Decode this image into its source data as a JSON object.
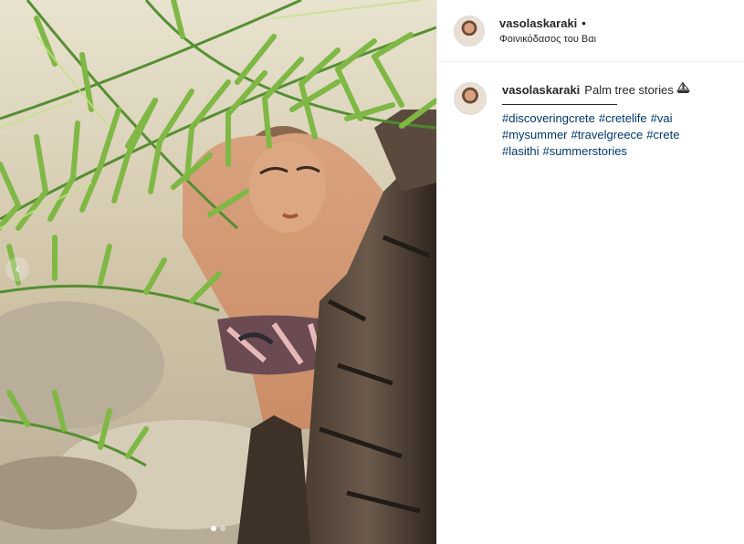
{
  "post": {
    "username": "vasolaskaraki",
    "header_separator": "•",
    "location": "Φοινικόδασος του Βαι"
  },
  "caption": {
    "username": "vasolaskaraki",
    "text": "Palm tree stories",
    "emoji_icon": "boat-emoji-icon",
    "hashtags": [
      "#discoveringcrete",
      "#cretelife",
      "#vai",
      "#mysummer",
      "#travelgreece",
      "#crete",
      "#lasithi",
      "#summerstories"
    ]
  },
  "carousel": {
    "prev_icon": "chevron-left-icon",
    "current": 1,
    "total": 2
  },
  "colors": {
    "username": "#262626",
    "hashtag": "#00376b",
    "divider": "#efefef"
  }
}
